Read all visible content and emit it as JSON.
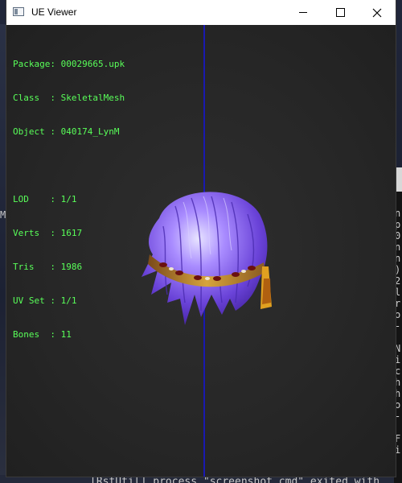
{
  "window": {
    "title": "UE Viewer",
    "controls": {
      "minimize": "minimize",
      "maximize": "maximize",
      "close": "close"
    }
  },
  "info": {
    "package": "Package: 00029665.upk",
    "class": "Class  : SkeletalMesh",
    "object": "Object : 040174_LynM",
    "lod": "LOD    : 1/1",
    "verts": "Verts  : 1617",
    "tris": "Tris   : 1986",
    "uvset": "UV Set : 1/1",
    "bones": "Bones  : 11"
  },
  "background": {
    "left_char": "M",
    "right_console": [
      "n",
      "p",
      "0",
      "n",
      "n",
      ")",
      "2",
      "l",
      "r",
      "o",
      "-",
      "",
      "N",
      "i",
      "c",
      "h",
      "h",
      "o",
      "-",
      "",
      "F",
      "i"
    ],
    "bottom_text": "[RstUtil] process \"screenshot.cmd\" exited with"
  },
  "colors": {
    "info_text": "#59ff59",
    "axis_line": "#1919b0",
    "viewport_bg": "#262626",
    "hair_purple": "#7b5be6",
    "headband_gold": "#c8902a"
  },
  "icons": {
    "app": "app-window-icon",
    "minimize": "minimize-icon",
    "maximize": "maximize-icon",
    "close": "close-icon"
  }
}
